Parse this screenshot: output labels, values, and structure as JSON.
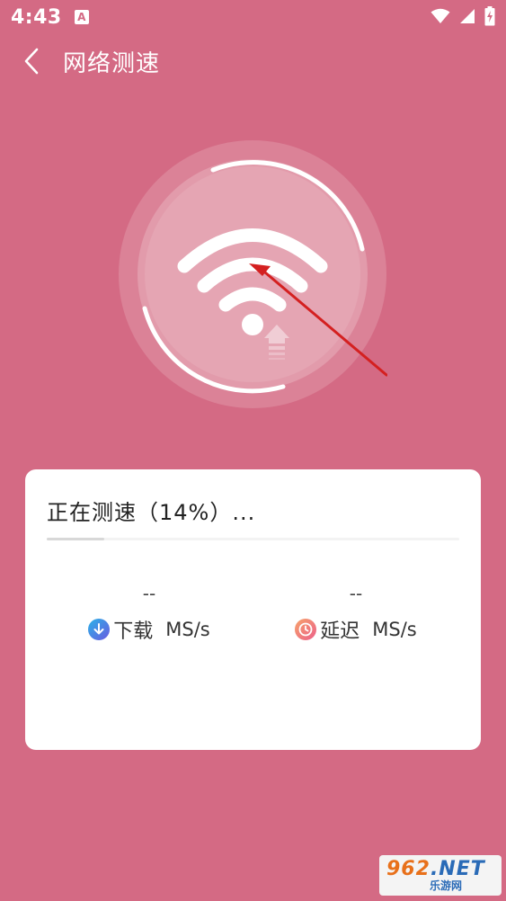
{
  "status_bar": {
    "time": "4:43",
    "app_icon": "A",
    "icons": [
      "wifi-icon",
      "signal-icon",
      "battery-charging-icon"
    ]
  },
  "header": {
    "back_icon": "chevron-left-icon",
    "title": "网络测速"
  },
  "gauge": {
    "icon": "wifi-icon",
    "arrow_icon": "upload-arrow-icon"
  },
  "card": {
    "progress_text": "正在测速（14%）...",
    "progress": 0.14,
    "download": {
      "value": "--",
      "label": "下载",
      "unit": "MS/s",
      "icon": "download-arrow-icon",
      "color": "#2ba0e6"
    },
    "latency": {
      "value": "--",
      "label": "延迟",
      "unit": "MS/s",
      "icon": "clock-icon",
      "color": "#f07f86"
    }
  },
  "watermark": {
    "top_a": "962",
    "top_b": ".NET",
    "bottom": "乐游网"
  },
  "colors": {
    "background": "#d46a84",
    "card": "#ffffff",
    "annotation_arrow": "#d42020"
  }
}
